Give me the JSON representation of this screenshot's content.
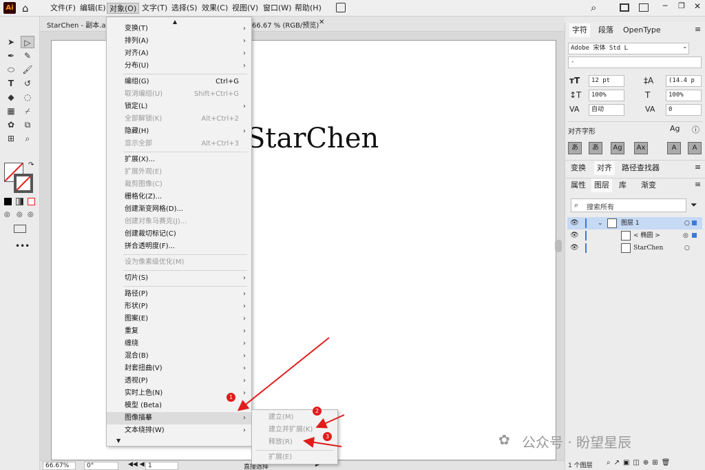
{
  "app": {
    "logo": "Ai"
  },
  "menubar": {
    "items": [
      "文件(F)",
      "编辑(E)",
      "对象(O)",
      "文字(T)",
      "选择(S)",
      "效果(C)",
      "视图(V)",
      "窗口(W)",
      "帮助(H)"
    ]
  },
  "document": {
    "tab_title": "StarChen - 副本.ai",
    "tab_info": "66.67 % (RGB/预览)",
    "canvas_text": "StarChen"
  },
  "object_menu": {
    "items": [
      {
        "label": "变换(T)"
      },
      {
        "label": "排列(A)"
      },
      {
        "label": "对齐(A)"
      },
      {
        "label": "分布(U)"
      },
      {
        "label": "编组(G)",
        "shortcut": "Ctrl+G"
      },
      {
        "label": "取消编组(U)",
        "shortcut": "Shift+Ctrl+G"
      },
      {
        "label": "锁定(L)"
      },
      {
        "label": "全部解锁(K)",
        "shortcut": "Alt+Ctrl+2"
      },
      {
        "label": "隐藏(H)"
      },
      {
        "label": "显示全部",
        "shortcut": "Alt+Ctrl+3"
      },
      {
        "label": "扩展(X)..."
      },
      {
        "label": "扩展外观(E)"
      },
      {
        "label": "裁剪图像(C)"
      },
      {
        "label": "栅格化(Z)..."
      },
      {
        "label": "创建渐变网格(D)..."
      },
      {
        "label": "创建对象马赛克(J)..."
      },
      {
        "label": "创建裁切标记(C)"
      },
      {
        "label": "拼合透明度(F)..."
      },
      {
        "label": "设为像素级优化(M)"
      },
      {
        "label": "切片(S)"
      },
      {
        "label": "路径(P)"
      },
      {
        "label": "形状(P)"
      },
      {
        "label": "图案(E)"
      },
      {
        "label": "重复"
      },
      {
        "label": "缠绕"
      },
      {
        "label": "混合(B)"
      },
      {
        "label": "封套扭曲(V)"
      },
      {
        "label": "透视(P)"
      },
      {
        "label": "实时上色(N)"
      },
      {
        "label": "模型 (Beta)"
      },
      {
        "label": "图像描摹"
      },
      {
        "label": "文本绕排(W)"
      }
    ]
  },
  "trace_submenu": {
    "items": [
      "建立(M)",
      "建立并扩展(K)",
      "释放(R)",
      "扩展(E)"
    ]
  },
  "badges": [
    "1",
    "2",
    "3"
  ],
  "right_panel": {
    "char_tabs": [
      "字符",
      "段落",
      "OpenType"
    ],
    "font_family": "Adobe 宋体 Std L",
    "font_style": "-",
    "font_size": "12 pt",
    "leading": "(14.4 p",
    "vscale": "100%",
    "hscale": "100%",
    "kerning": "自动",
    "tracking": "0",
    "glyphs_label": "对齐字形",
    "align_tabs": [
      "变换",
      "对齐",
      "路径查找器"
    ],
    "layer_tabs": [
      "属性",
      "图层",
      "库",
      "渐变"
    ],
    "search_placeholder": "搜索所有",
    "layers": [
      {
        "name": "图层 1"
      },
      {
        "name": "< 椭圆 >"
      },
      {
        "name": "StarChen"
      }
    ],
    "layer_count": "1 个图层"
  },
  "status": {
    "zoom": "66.67%",
    "rotation": "0°",
    "artboard_num": "1",
    "tool_name": "直接选择"
  },
  "watermark": "公众号 · 盼望星辰",
  "colors": {
    "accent": "#e21b1b",
    "selection": "#c6d9f5"
  }
}
